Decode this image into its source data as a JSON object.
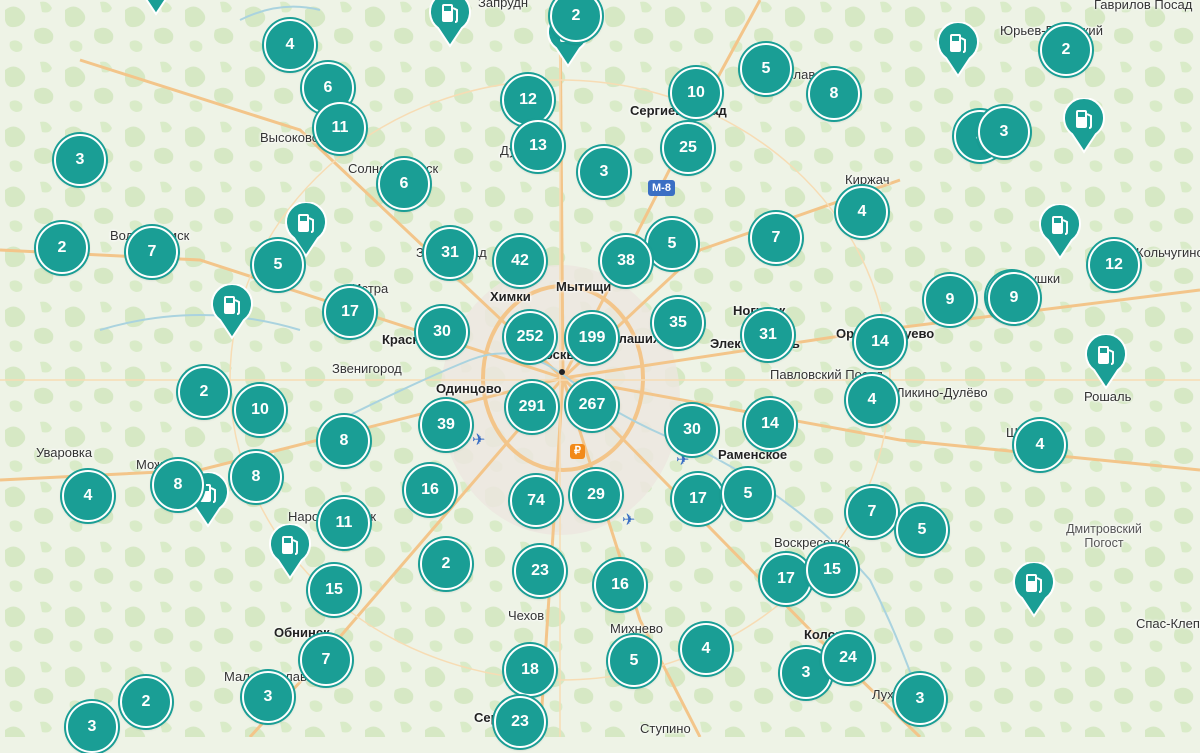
{
  "map": {
    "place_labels": [
      {
        "text": "Запрудн"
      },
      {
        "text": "Гаврилов Посад"
      },
      {
        "text": "Юрьев-Польский"
      },
      {
        "text": "Сергиев Посад"
      },
      {
        "text": "Переславль"
      },
      {
        "text": "Высоково"
      },
      {
        "text": "Солнечногорск"
      },
      {
        "text": "Киржач"
      },
      {
        "text": "Волоколамск"
      },
      {
        "text": "Зеленоград"
      },
      {
        "text": "Истра"
      },
      {
        "text": "Химки"
      },
      {
        "text": "Мытищи"
      },
      {
        "text": "Ногинск"
      },
      {
        "text": "Красногорск"
      },
      {
        "text": "Балашиха"
      },
      {
        "text": "Электросталь"
      },
      {
        "text": "Орехово-Зуево"
      },
      {
        "text": "Звенигород"
      },
      {
        "text": "Москва"
      },
      {
        "text": "Павловский Посад"
      },
      {
        "text": "Ликино-Дулёво"
      },
      {
        "text": "Одинцово"
      },
      {
        "text": "Рошаль"
      },
      {
        "text": "Уваровка"
      },
      {
        "text": "Можайск"
      },
      {
        "text": "Раменское"
      },
      {
        "text": "Наро-Фоминск"
      },
      {
        "text": "Воскресенск"
      },
      {
        "text": "Дмитровский Погост"
      },
      {
        "text": "Обнинск"
      },
      {
        "text": "Чехов"
      },
      {
        "text": "Михнево"
      },
      {
        "text": "Коломна"
      },
      {
        "text": "Малоярославец"
      },
      {
        "text": "Спас-Клепики"
      },
      {
        "text": "Серпухов"
      },
      {
        "text": "Ступино"
      },
      {
        "text": "Луховицы"
      },
      {
        "text": "Шатура"
      },
      {
        "text": "Петушки"
      },
      {
        "text": "Кольчугино"
      },
      {
        "text": "Дубна"
      }
    ],
    "road_badges": [
      "М-8"
    ],
    "clusters": [
      {
        "count": "2"
      },
      {
        "count": "4"
      },
      {
        "count": "6"
      },
      {
        "count": "11"
      },
      {
        "count": "3"
      },
      {
        "count": "6"
      },
      {
        "count": "12"
      },
      {
        "count": "13"
      },
      {
        "count": "3"
      },
      {
        "count": "10"
      },
      {
        "count": "25"
      },
      {
        "count": "5"
      },
      {
        "count": "8"
      },
      {
        "count": "2"
      },
      {
        "count": "3"
      },
      {
        "count": "3"
      },
      {
        "count": "4"
      },
      {
        "count": "7"
      },
      {
        "count": "5"
      },
      {
        "count": "2"
      },
      {
        "count": "7"
      },
      {
        "count": "5"
      },
      {
        "count": "31"
      },
      {
        "count": "42"
      },
      {
        "count": "38"
      },
      {
        "count": "5"
      },
      {
        "count": "17"
      },
      {
        "count": "12"
      },
      {
        "count": "9"
      },
      {
        "count": "9"
      },
      {
        "count": "30"
      },
      {
        "count": "252"
      },
      {
        "count": "199"
      },
      {
        "count": "35"
      },
      {
        "count": "31"
      },
      {
        "count": "14"
      },
      {
        "count": "2"
      },
      {
        "count": "10"
      },
      {
        "count": "291"
      },
      {
        "count": "267"
      },
      {
        "count": "4"
      },
      {
        "count": "39"
      },
      {
        "count": "8"
      },
      {
        "count": "30"
      },
      {
        "count": "14"
      },
      {
        "count": "4"
      },
      {
        "count": "8"
      },
      {
        "count": "8"
      },
      {
        "count": "4"
      },
      {
        "count": "16"
      },
      {
        "count": "74"
      },
      {
        "count": "29"
      },
      {
        "count": "17"
      },
      {
        "count": "5"
      },
      {
        "count": "7"
      },
      {
        "count": "11"
      },
      {
        "count": "5"
      },
      {
        "count": "2"
      },
      {
        "count": "23"
      },
      {
        "count": "16"
      },
      {
        "count": "17"
      },
      {
        "count": "15"
      },
      {
        "count": "15"
      },
      {
        "count": "7"
      },
      {
        "count": "18"
      },
      {
        "count": "5"
      },
      {
        "count": "4"
      },
      {
        "count": "3"
      },
      {
        "count": "24"
      },
      {
        "count": "2"
      },
      {
        "count": "3"
      },
      {
        "count": "3"
      },
      {
        "count": "23"
      },
      {
        "count": "3"
      }
    ],
    "pins": [
      {
        "icon": "fuel-pump-icon"
      },
      {
        "icon": "fuel-pump-icon"
      },
      {
        "icon": "fuel-pump-icon"
      },
      {
        "icon": "fuel-pump-icon"
      },
      {
        "icon": "fuel-pump-icon"
      },
      {
        "icon": "fuel-pump-icon"
      },
      {
        "icon": "fuel-pump-icon"
      },
      {
        "icon": "fuel-pump-icon"
      },
      {
        "icon": "fuel-pump-icon"
      },
      {
        "icon": "fuel-pump-icon"
      },
      {
        "icon": "fuel-pump-icon"
      },
      {
        "icon": "fuel-pump-icon"
      }
    ],
    "colors": {
      "cluster": "#1a9e95",
      "background": "#eef3e6",
      "forest": "#d6e8c4",
      "road": "#f3c58a",
      "water": "#aad3df"
    }
  }
}
